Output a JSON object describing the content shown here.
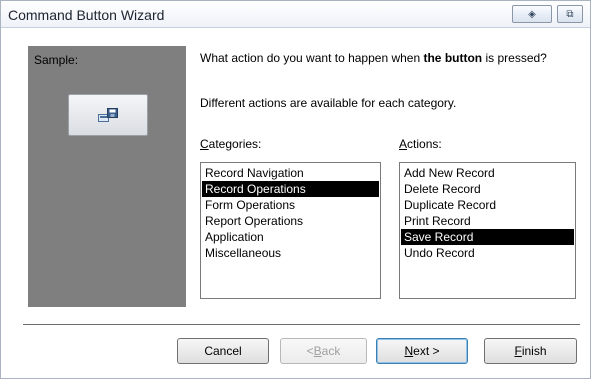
{
  "window": {
    "title": "Command Button Wizard"
  },
  "titlebar_buttons": [
    {
      "icon": "help-icon",
      "glyph": "◈"
    },
    {
      "icon": "restore-icon",
      "glyph": "⧉"
    }
  ],
  "sample": {
    "label": "Sample:",
    "button_icon": "save-record-icon"
  },
  "question": {
    "prefix": "What action do you want to happen when ",
    "bold": "the button",
    "suffix": " is pressed?"
  },
  "description": "Different actions are available for each category.",
  "categories": {
    "label_accel": "C",
    "label_rest": "ategories:",
    "items": [
      "Record Navigation",
      "Record Operations",
      "Form Operations",
      "Report Operations",
      "Application",
      "Miscellaneous"
    ],
    "selected": "Record Operations"
  },
  "actions": {
    "label_accel": "A",
    "label_rest": "ctions:",
    "items": [
      "Add New Record",
      "Delete Record",
      "Duplicate Record",
      "Print Record",
      "Save Record",
      "Undo Record"
    ],
    "selected": "Save Record"
  },
  "buttons": {
    "cancel": "Cancel",
    "back_pre": "< ",
    "back_accel": "B",
    "back_rest": "ack",
    "next_accel": "N",
    "next_rest": "ext >",
    "finish_accel": "F",
    "finish_rest": "inish"
  },
  "colors": {
    "selection_bg": "#000000",
    "sample_panel": "#7f7f7f"
  }
}
